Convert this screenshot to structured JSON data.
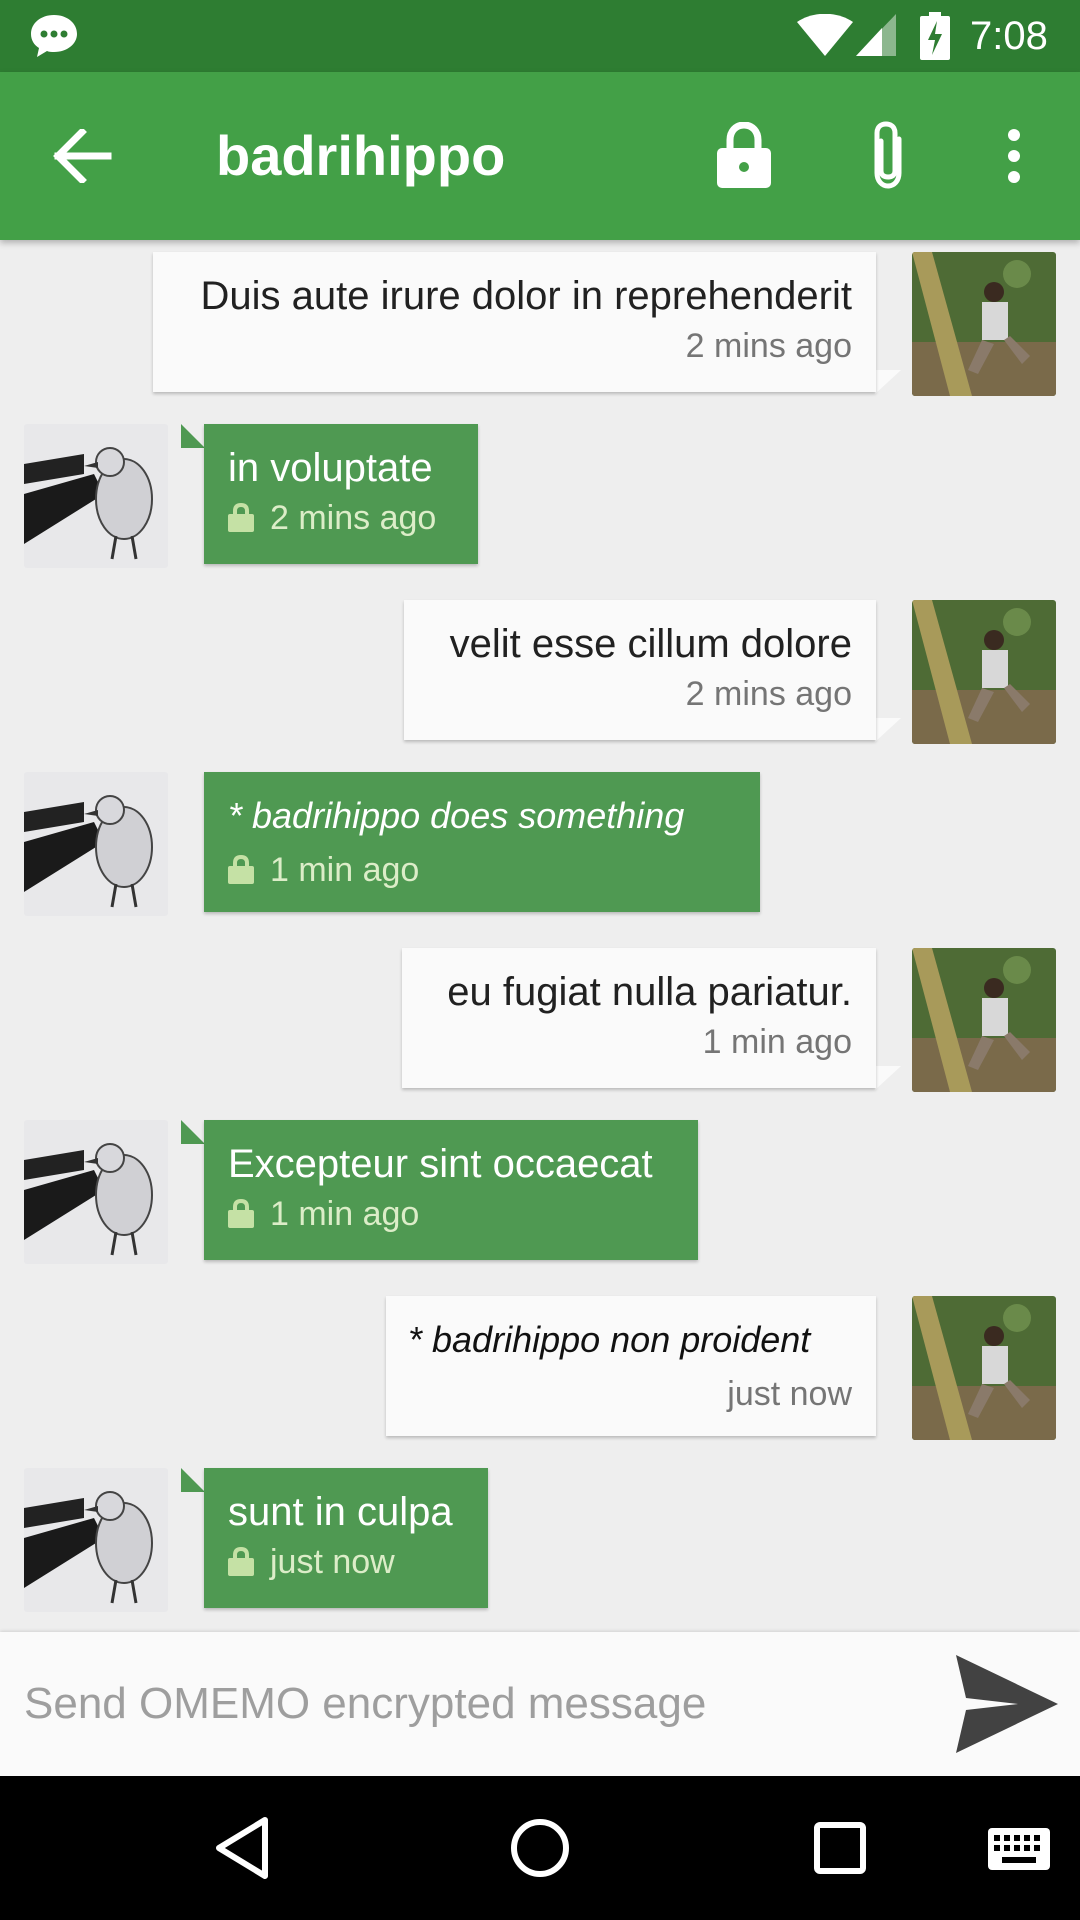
{
  "status_bar": {
    "time": "7:08"
  },
  "app_bar": {
    "title": "badrihippo"
  },
  "messages": [
    {
      "direction": "sent",
      "text": "Duis aute irure dolor in reprehenderit",
      "time": "2 mins ago",
      "encrypted": false,
      "emote": false
    },
    {
      "direction": "received",
      "text": "in voluptate",
      "time": "2 mins ago",
      "encrypted": true,
      "emote": false
    },
    {
      "direction": "sent",
      "text": "velit esse cillum dolore",
      "time": "2 mins ago",
      "encrypted": false,
      "emote": false
    },
    {
      "direction": "received",
      "text": "* badrihippo does something",
      "time": "1 min ago",
      "encrypted": true,
      "emote": true
    },
    {
      "direction": "sent",
      "text": "eu fugiat nulla pariatur.",
      "time": "1 min ago",
      "encrypted": false,
      "emote": false
    },
    {
      "direction": "received",
      "text": "Excepteur sint occaecat",
      "time": "1 min ago",
      "encrypted": true,
      "emote": false
    },
    {
      "direction": "sent",
      "text": "* badrihippo non proident",
      "time": "just now",
      "encrypted": false,
      "emote": true
    },
    {
      "direction": "received",
      "text": "sunt in culpa",
      "time": "just now",
      "encrypted": true,
      "emote": false
    }
  ],
  "composer": {
    "placeholder": "Send OMEMO encrypted message",
    "value": ""
  },
  "icons": {
    "status": [
      "chat-app-icon",
      "wifi-icon",
      "signal-icon",
      "battery-charging-icon"
    ],
    "app_bar": [
      "back-arrow-icon",
      "lock-icon",
      "attach-icon",
      "more-vert-icon"
    ],
    "composer": [
      "send-icon"
    ],
    "nav": [
      "nav-back-icon",
      "nav-home-icon",
      "nav-recents-icon",
      "keyboard-icon"
    ]
  },
  "colors": {
    "status_bar": "#2e7d32",
    "app_bar": "#43a047",
    "received_bubble": "#4f9952",
    "sent_bubble": "#fafafa",
    "background": "#eeeeee"
  }
}
